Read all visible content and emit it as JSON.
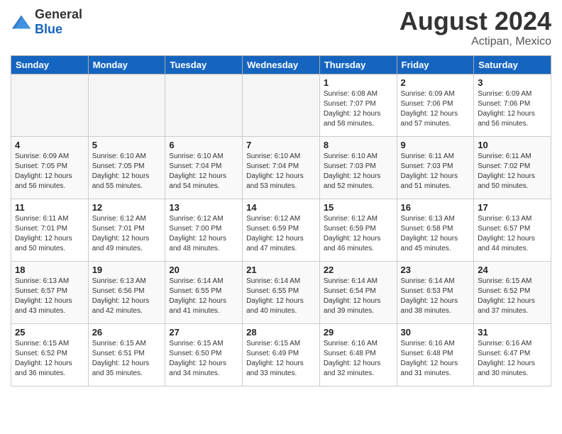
{
  "header": {
    "logo_general": "General",
    "logo_blue": "Blue",
    "month_year": "August 2024",
    "location": "Actipan, Mexico"
  },
  "weekdays": [
    "Sunday",
    "Monday",
    "Tuesday",
    "Wednesday",
    "Thursday",
    "Friday",
    "Saturday"
  ],
  "weeks": [
    [
      {
        "day": "",
        "info": ""
      },
      {
        "day": "",
        "info": ""
      },
      {
        "day": "",
        "info": ""
      },
      {
        "day": "",
        "info": ""
      },
      {
        "day": "1",
        "info": "Sunrise: 6:08 AM\nSunset: 7:07 PM\nDaylight: 12 hours\nand 58 minutes."
      },
      {
        "day": "2",
        "info": "Sunrise: 6:09 AM\nSunset: 7:06 PM\nDaylight: 12 hours\nand 57 minutes."
      },
      {
        "day": "3",
        "info": "Sunrise: 6:09 AM\nSunset: 7:06 PM\nDaylight: 12 hours\nand 56 minutes."
      }
    ],
    [
      {
        "day": "4",
        "info": "Sunrise: 6:09 AM\nSunset: 7:05 PM\nDaylight: 12 hours\nand 56 minutes."
      },
      {
        "day": "5",
        "info": "Sunrise: 6:10 AM\nSunset: 7:05 PM\nDaylight: 12 hours\nand 55 minutes."
      },
      {
        "day": "6",
        "info": "Sunrise: 6:10 AM\nSunset: 7:04 PM\nDaylight: 12 hours\nand 54 minutes."
      },
      {
        "day": "7",
        "info": "Sunrise: 6:10 AM\nSunset: 7:04 PM\nDaylight: 12 hours\nand 53 minutes."
      },
      {
        "day": "8",
        "info": "Sunrise: 6:10 AM\nSunset: 7:03 PM\nDaylight: 12 hours\nand 52 minutes."
      },
      {
        "day": "9",
        "info": "Sunrise: 6:11 AM\nSunset: 7:03 PM\nDaylight: 12 hours\nand 51 minutes."
      },
      {
        "day": "10",
        "info": "Sunrise: 6:11 AM\nSunset: 7:02 PM\nDaylight: 12 hours\nand 50 minutes."
      }
    ],
    [
      {
        "day": "11",
        "info": "Sunrise: 6:11 AM\nSunset: 7:01 PM\nDaylight: 12 hours\nand 50 minutes."
      },
      {
        "day": "12",
        "info": "Sunrise: 6:12 AM\nSunset: 7:01 PM\nDaylight: 12 hours\nand 49 minutes."
      },
      {
        "day": "13",
        "info": "Sunrise: 6:12 AM\nSunset: 7:00 PM\nDaylight: 12 hours\nand 48 minutes."
      },
      {
        "day": "14",
        "info": "Sunrise: 6:12 AM\nSunset: 6:59 PM\nDaylight: 12 hours\nand 47 minutes."
      },
      {
        "day": "15",
        "info": "Sunrise: 6:12 AM\nSunset: 6:59 PM\nDaylight: 12 hours\nand 46 minutes."
      },
      {
        "day": "16",
        "info": "Sunrise: 6:13 AM\nSunset: 6:58 PM\nDaylight: 12 hours\nand 45 minutes."
      },
      {
        "day": "17",
        "info": "Sunrise: 6:13 AM\nSunset: 6:57 PM\nDaylight: 12 hours\nand 44 minutes."
      }
    ],
    [
      {
        "day": "18",
        "info": "Sunrise: 6:13 AM\nSunset: 6:57 PM\nDaylight: 12 hours\nand 43 minutes."
      },
      {
        "day": "19",
        "info": "Sunrise: 6:13 AM\nSunset: 6:56 PM\nDaylight: 12 hours\nand 42 minutes."
      },
      {
        "day": "20",
        "info": "Sunrise: 6:14 AM\nSunset: 6:55 PM\nDaylight: 12 hours\nand 41 minutes."
      },
      {
        "day": "21",
        "info": "Sunrise: 6:14 AM\nSunset: 6:55 PM\nDaylight: 12 hours\nand 40 minutes."
      },
      {
        "day": "22",
        "info": "Sunrise: 6:14 AM\nSunset: 6:54 PM\nDaylight: 12 hours\nand 39 minutes."
      },
      {
        "day": "23",
        "info": "Sunrise: 6:14 AM\nSunset: 6:53 PM\nDaylight: 12 hours\nand 38 minutes."
      },
      {
        "day": "24",
        "info": "Sunrise: 6:15 AM\nSunset: 6:52 PM\nDaylight: 12 hours\nand 37 minutes."
      }
    ],
    [
      {
        "day": "25",
        "info": "Sunrise: 6:15 AM\nSunset: 6:52 PM\nDaylight: 12 hours\nand 36 minutes."
      },
      {
        "day": "26",
        "info": "Sunrise: 6:15 AM\nSunset: 6:51 PM\nDaylight: 12 hours\nand 35 minutes."
      },
      {
        "day": "27",
        "info": "Sunrise: 6:15 AM\nSunset: 6:50 PM\nDaylight: 12 hours\nand 34 minutes."
      },
      {
        "day": "28",
        "info": "Sunrise: 6:15 AM\nSunset: 6:49 PM\nDaylight: 12 hours\nand 33 minutes."
      },
      {
        "day": "29",
        "info": "Sunrise: 6:16 AM\nSunset: 6:48 PM\nDaylight: 12 hours\nand 32 minutes."
      },
      {
        "day": "30",
        "info": "Sunrise: 6:16 AM\nSunset: 6:48 PM\nDaylight: 12 hours\nand 31 minutes."
      },
      {
        "day": "31",
        "info": "Sunrise: 6:16 AM\nSunset: 6:47 PM\nDaylight: 12 hours\nand 30 minutes."
      }
    ]
  ]
}
